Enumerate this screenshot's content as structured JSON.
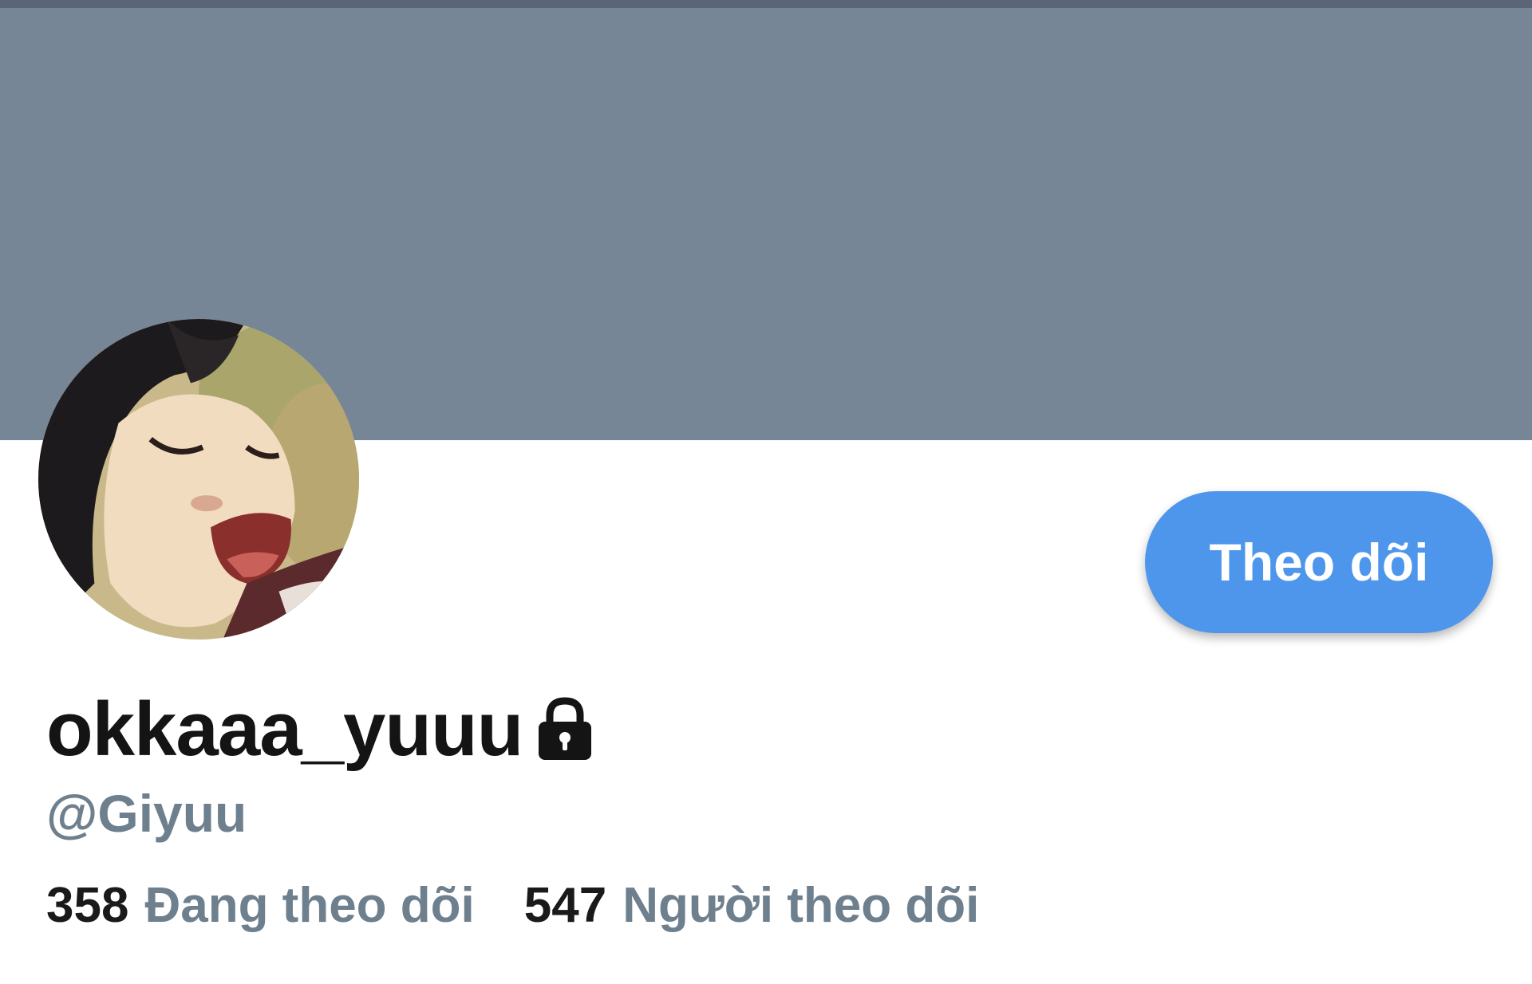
{
  "profile": {
    "display_name": "okkaaa_yuuu",
    "handle": "@Giyuu",
    "protected_icon": "lock-icon",
    "follow_button_label": "Theo dõi"
  },
  "stats": {
    "following_count": "358",
    "following_label": "Đang theo dõi",
    "followers_count": "547",
    "followers_label": "Người theo dõi"
  },
  "colors": {
    "banner": "#768696",
    "accent": "#4d96eb",
    "secondary_text": "#6e7f8e",
    "primary_text": "#141414"
  }
}
